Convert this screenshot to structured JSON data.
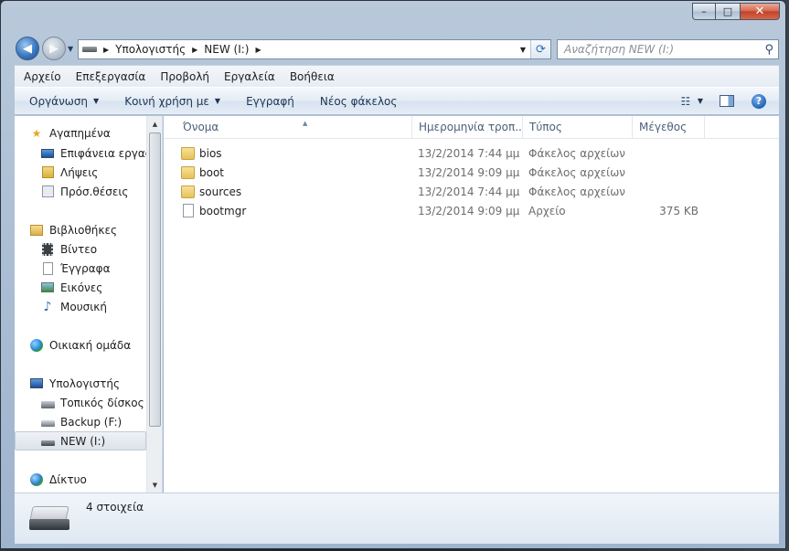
{
  "window": {
    "caption": {
      "minimize": "–",
      "maximize": "□",
      "close": "✕"
    }
  },
  "navigation": {
    "back_glyph": "◀",
    "forward_glyph": "▶",
    "breadcrumbs": [
      "Υπολογιστής",
      "NEW (I:)"
    ],
    "search_placeholder": "Αναζήτηση NEW (I:)"
  },
  "menubar": [
    "Αρχείο",
    "Επεξεργασία",
    "Προβολή",
    "Εργαλεία",
    "Βοήθεια"
  ],
  "commandbar": {
    "organize": "Οργάνωση",
    "share": "Κοινή χρήση με",
    "burn": "Εγγραφή",
    "new_folder": "Νέος φάκελος"
  },
  "navpane": {
    "favorites": {
      "label": "Αγαπημένα",
      "items": [
        "Επιφάνεια εργασίας",
        "Λήψεις",
        "Πρόσ.θέσεις"
      ]
    },
    "libraries": {
      "label": "Βιβλιοθήκες",
      "items": [
        "Βίντεο",
        "Έγγραφα",
        "Εικόνες",
        "Μουσική"
      ]
    },
    "homegroup": "Οικιακή ομάδα",
    "computer": {
      "label": "Υπολογιστής",
      "items": [
        "Τοπικός δίσκος (C:)",
        "Backup (F:)",
        "NEW (I:)"
      ]
    },
    "network": "Δίκτυο"
  },
  "columns": {
    "name": "Όνομα",
    "date": "Ημερομηνία τροπ...",
    "type": "Τύπος",
    "size": "Μέγεθος"
  },
  "files": [
    {
      "name": "bios",
      "date": "13/2/2014 7:44 μμ",
      "type": "Φάκελος αρχείων",
      "size": "",
      "kind": "folder"
    },
    {
      "name": "boot",
      "date": "13/2/2014 9:09 μμ",
      "type": "Φάκελος αρχείων",
      "size": "",
      "kind": "folder"
    },
    {
      "name": "sources",
      "date": "13/2/2014 7:44 μμ",
      "type": "Φάκελος αρχείων",
      "size": "",
      "kind": "folder"
    },
    {
      "name": "bootmgr",
      "date": "13/2/2014 9:09 μμ",
      "type": "Αρχείο",
      "size": "375 KB",
      "kind": "file"
    }
  ],
  "status": {
    "item_count": "4 στοιχεία"
  },
  "colors": {
    "accent": "#2a6db8",
    "frame": "#a7bbd2"
  }
}
